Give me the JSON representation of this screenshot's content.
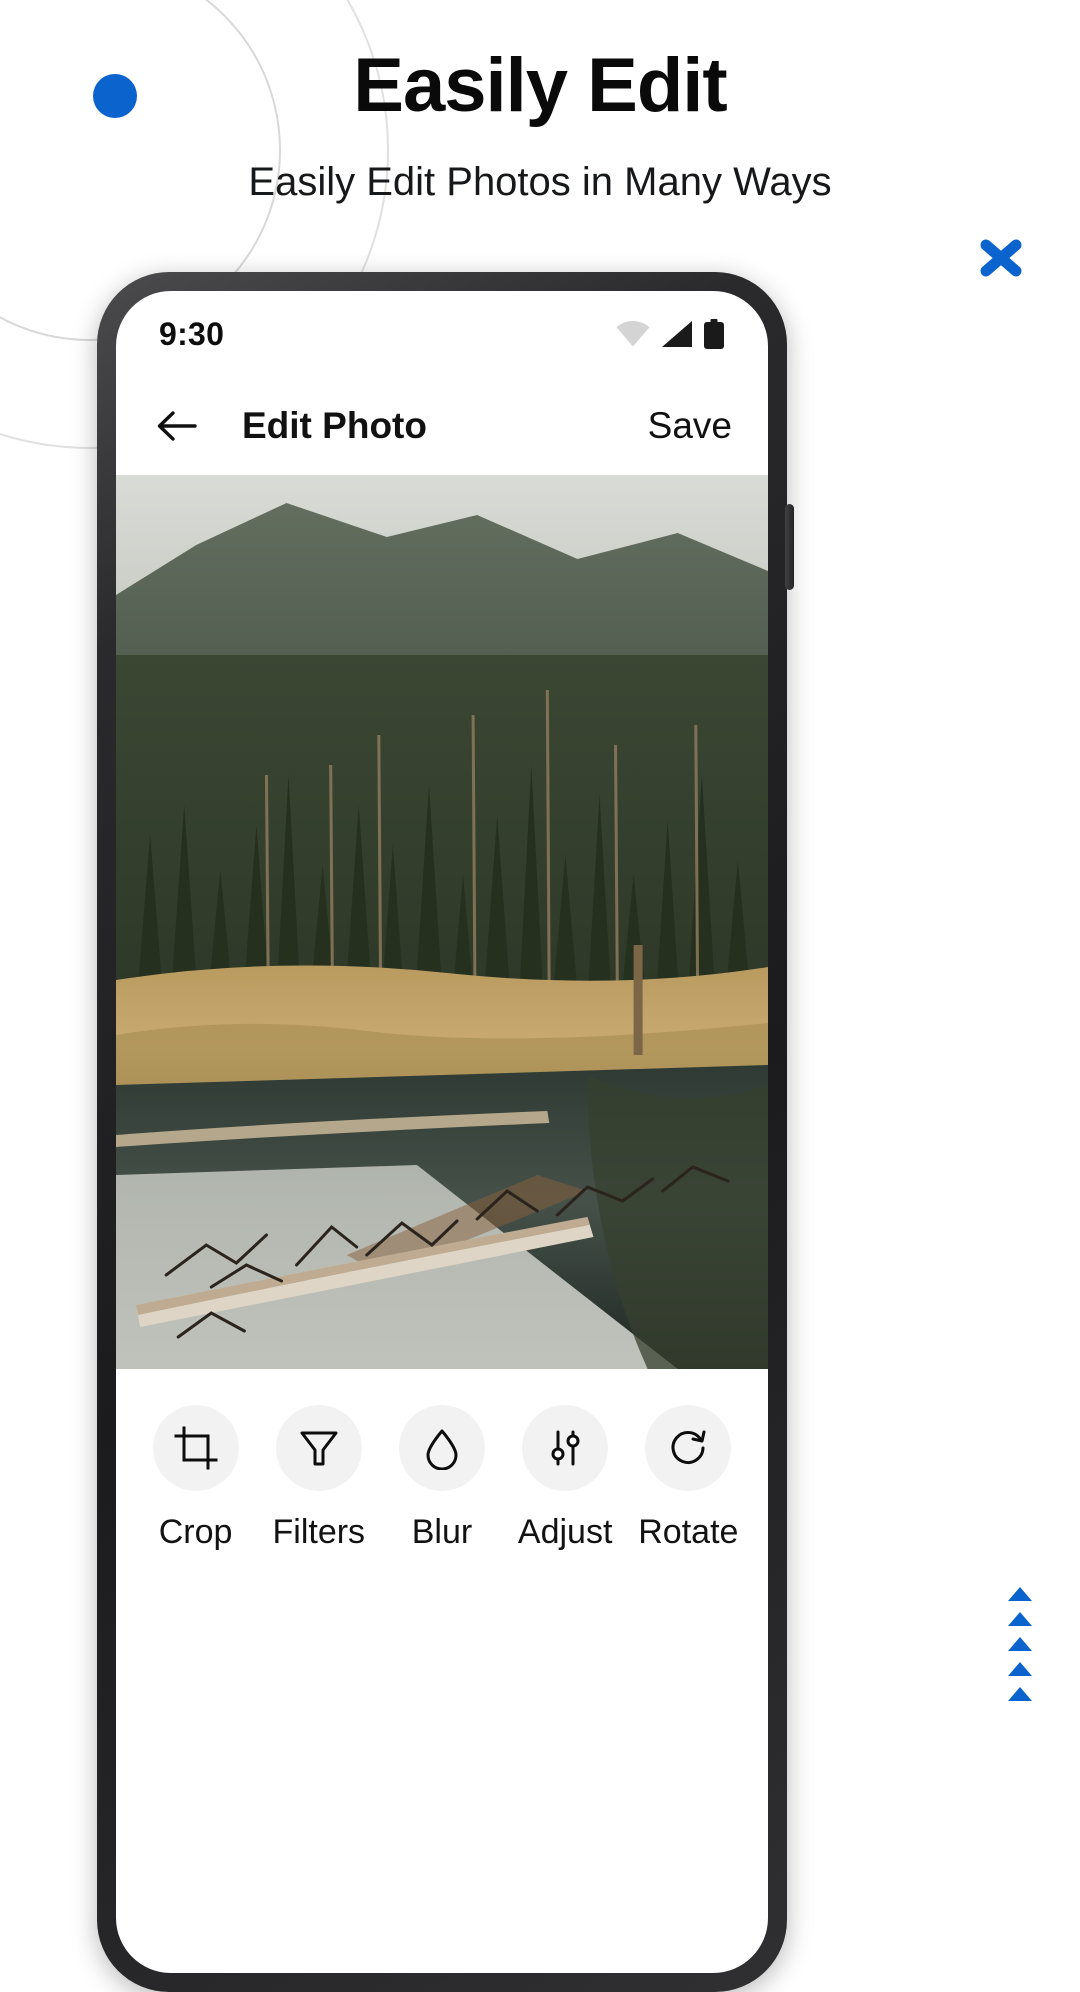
{
  "promo": {
    "headline": "Easily Edit",
    "subheadline": "Easily Edit Photos in Many Ways",
    "accent_color": "#0b63ce",
    "decorations": {
      "dot": "blue-dot",
      "x_mark": "blue-x-mark",
      "triangles_count": 5,
      "arcs": "concentric-arcs"
    }
  },
  "phone": {
    "status_bar": {
      "time": "9:30",
      "icons": [
        "wifi-icon",
        "cellular-signal-icon",
        "battery-icon"
      ]
    },
    "app_bar": {
      "back_icon": "back-arrow-icon",
      "title": "Edit Photo",
      "save_label": "Save"
    },
    "photo": {
      "alt": "forest-lake-photo"
    },
    "tools": [
      {
        "label": "Crop",
        "icon": "crop-icon"
      },
      {
        "label": "Filters",
        "icon": "filter-funnel-icon"
      },
      {
        "label": "Blur",
        "icon": "water-drop-icon"
      },
      {
        "label": "Adjust",
        "icon": "sliders-icon"
      },
      {
        "label": "Rotate",
        "icon": "rotate-icon"
      }
    ]
  }
}
